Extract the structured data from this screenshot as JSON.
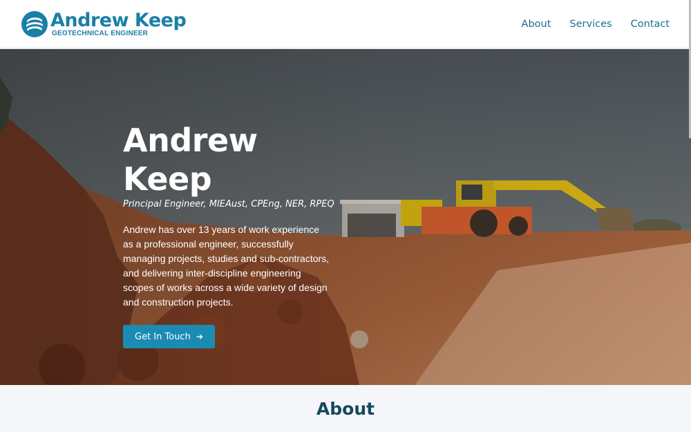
{
  "header": {
    "brand_name": "Andrew Keep",
    "brand_tagline": "GEOTECHNICAL ENGINEER",
    "logo_icon": "logo-mark-icon",
    "brand_color": "#1a7fa7",
    "nav": [
      {
        "label": "About"
      },
      {
        "label": "Services"
      },
      {
        "label": "Contact"
      }
    ]
  },
  "hero": {
    "title": "Andrew Keep",
    "subtitle": "Principal Engineer, MIEAust, CPEng, NER, RPEQ",
    "body": "Andrew has over 13 years of work experience as a professional engineer, successfully managing projects, studies and sub-contractors, and delivering inter-discipline engineering scopes of works across a wide variety of design and construction projects.",
    "cta_label": "Get In Touch",
    "cta_icon": "arrow-right-icon",
    "cta_color": "#1b8bb3",
    "background_image": "construction-site-excavator"
  },
  "about": {
    "heading": "About"
  }
}
